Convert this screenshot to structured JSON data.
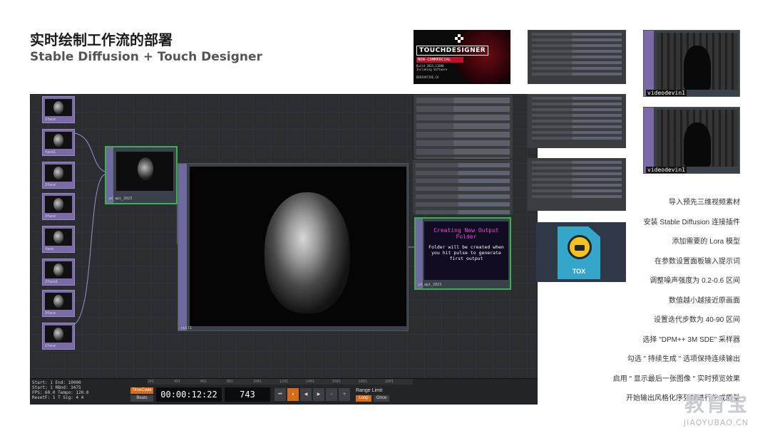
{
  "title": {
    "cn": "实时绘制工作流的部署",
    "en": "Stable Diffusion + Touch Designer"
  },
  "network": {
    "source_nodes": [
      "1face",
      "face1",
      "2face",
      "3face",
      "face",
      "2face1",
      "3face",
      "1face",
      "face"
    ],
    "small_node_label": "sd_api_2023",
    "main_node_label": "null1",
    "output_node": {
      "title": "Creating New Output Folder",
      "body": "Folder will be created when you hit pulse to generate first output",
      "label": "sd_api_2023"
    }
  },
  "timeline": {
    "info": [
      "Start:   1       End:    10000",
      "Start:   1       RBnd:   3475",
      "FPS:     60.0    Tempo:  120.0",
      "ResetF:  1       T Sig:  4  4"
    ],
    "ruler": [
      "201",
      "401",
      "601",
      "801",
      "1001",
      "1201",
      "1401",
      "1601",
      "1801",
      "2001"
    ],
    "timecode_button": "TimeCode",
    "beats_button": "Beats",
    "timecode": "00:00:12:22",
    "frame": "743",
    "transport": [
      "⏮",
      "⏸",
      "◀",
      "▶",
      "−",
      "+"
    ],
    "range_label": "Range Limit",
    "loop_button": "Loop",
    "once_button": "Once"
  },
  "splash": {
    "logo": "TOUCHDESIGNER",
    "edition": "NON-COMMERCIAL",
    "info": [
      "Build 2023.11880",
      "Including Software"
    ],
    "site": "DERIVATIVE.CA"
  },
  "tox_label": "TOX",
  "video_nodes": [
    "videodevin1",
    "videodevin1"
  ],
  "steps": [
    "导入预先三维视频素材",
    "安装 Stable Diffusion 连接插件",
    "添加需要的 Lora 模型",
    "在参数设置面板输入提示词",
    "调整噪声强度为 0.2-0.6 区间",
    "数值越小越接近原画面",
    "设置迭代步数为 40-90 区间",
    "选择 \"DPM++ 3M SDE\" 采样器",
    "勾选 \" 持续生成 \" 选项保持连续输出",
    "启用 \" 显示最后一张图像 \" 实时预览效果",
    "开始输出风格化序列帧进行生成质量"
  ],
  "watermark": {
    "text": "教育宝",
    "url": "JIAOYUBAO.CN"
  },
  "colors": {
    "accent_orange": "#d86b16",
    "selection_green": "#35b44a",
    "node_purple": "#7b6aa8",
    "output_magenta": "#e54bd6"
  }
}
